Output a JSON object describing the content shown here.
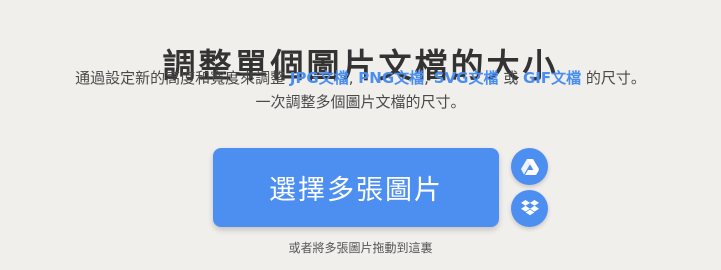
{
  "header": {
    "title": "調整單個圖片文檔的大小"
  },
  "subtitle": {
    "prefix": "通過設定新的高度和寬度來調整 ",
    "jpg": "JPG文檔",
    "sep1": ", ",
    "png": "PNG文檔",
    "sep2": ", ",
    "svg": "SVG文檔",
    "or": " 或 ",
    "gif": "GIF文檔",
    "suffix": " 的尺寸。",
    "line2": "一次調整多個圖片文檔的尺寸。",
    "link_color": "#4a8ef0"
  },
  "upload": {
    "select_label": "選擇多張圖片",
    "button_color": "#4d8ff0",
    "cloud_buttons": [
      {
        "icon": "google-drive-icon"
      },
      {
        "icon": "dropbox-icon"
      }
    ],
    "drop_hint": "或者將多張圖片拖動到這裏"
  }
}
